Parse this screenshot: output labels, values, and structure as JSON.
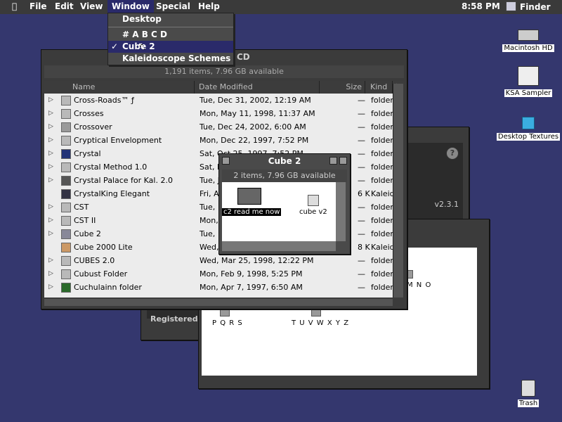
{
  "menubar": {
    "apple_glyph": "",
    "items": [
      "File",
      "Edit",
      "View",
      "Window",
      "Special",
      "Help"
    ],
    "clock": "8:58 PM",
    "app_name": "Finder"
  },
  "window_menu": {
    "items": [
      {
        "label": "Desktop"
      },
      {
        "label": "# A B C D"
      },
      {
        "label": "Cube 2",
        "checked": true
      },
      {
        "label": "Kaleidoscope Schemes"
      }
    ],
    "check_glyph": "✓"
  },
  "main_window": {
    "title_partial": "CD",
    "status": "1,191 items, 7.96 GB available",
    "columns": [
      "Name",
      "Date Modified",
      "Size",
      "Kind"
    ],
    "rows": [
      {
        "name": "Cross-Roads™ ƒ",
        "date": "Tue, Dec 31, 2002, 12:19 AM",
        "size": "—",
        "kind": "folder"
      },
      {
        "name": "Crosses",
        "date": "Mon, May 11, 1998, 11:37 AM",
        "size": "—",
        "kind": "folder"
      },
      {
        "name": "Crossover",
        "date": "Tue, Dec 24, 2002, 6:00 AM",
        "size": "—",
        "kind": "folder"
      },
      {
        "name": "Cryptical Envelopment",
        "date": "Mon, Dec 22, 1997, 7:52 PM",
        "size": "—",
        "kind": "folder"
      },
      {
        "name": "Crystal",
        "date": "Sat, Oct 25, 1997, 7:52 PM",
        "size": "—",
        "kind": "folder"
      },
      {
        "name": "Crystal Method 1.0",
        "date": "Sat, F",
        "size": "—",
        "kind": "folder"
      },
      {
        "name": "Crystal Palace for Kal. 2.0",
        "date": "Tue, J",
        "size": "—",
        "kind": "folder"
      },
      {
        "name": "CrystalKing Elegant",
        "date": "Fri, A",
        "size": "6 K",
        "kind": "Kaleid"
      },
      {
        "name": "CST",
        "date": "Tue, ",
        "size": "—",
        "kind": "folder"
      },
      {
        "name": "CST II",
        "date": "Mon, ",
        "size": "—",
        "kind": "folder"
      },
      {
        "name": "Cube 2",
        "date": "Tue, ",
        "size": "—",
        "kind": "folder"
      },
      {
        "name": "Cube 2000 Lite",
        "date": "Wed, ",
        "size": "8 K",
        "kind": "Kaleid"
      },
      {
        "name": "CUBES 2.0",
        "date": "Wed, Mar 25, 1998, 12:22 PM",
        "size": "—",
        "kind": "folder"
      },
      {
        "name": "Cubust Folder",
        "date": "Mon, Feb 9, 1998, 5:25 PM",
        "size": "—",
        "kind": "folder"
      },
      {
        "name": "Cuchulainn folder",
        "date": "Mon, Apr 7, 1997, 6:50 AM",
        "size": "—",
        "kind": "folder"
      }
    ]
  },
  "cube_window": {
    "title": "Cube 2",
    "status": "2 items, 7.96 GB available",
    "items": [
      {
        "label": "c2 read me now",
        "icon": "document-icon"
      },
      {
        "label": "cube v2",
        "icon": "cube-icon"
      }
    ]
  },
  "bg_window_1": {
    "version": "v2.3.1",
    "registered": "Registered T"
  },
  "bg_window_2": {
    "labels": [
      "M N O",
      "P Q R S",
      "T U V W X Y Z"
    ]
  },
  "desktop": {
    "icons": [
      {
        "label": "Macintosh HD",
        "icon": "hard-disk-icon"
      },
      {
        "label": "KSA Sampler",
        "icon": "paint-tool-icon"
      },
      {
        "label": "Desktop Textures",
        "icon": "cube-icon"
      },
      {
        "label": "Trash",
        "icon": "trash-icon"
      }
    ]
  },
  "colors": {
    "desktop": "#34376e",
    "menubar": "#3a3a3a",
    "highlight": "#2a2a6a"
  }
}
